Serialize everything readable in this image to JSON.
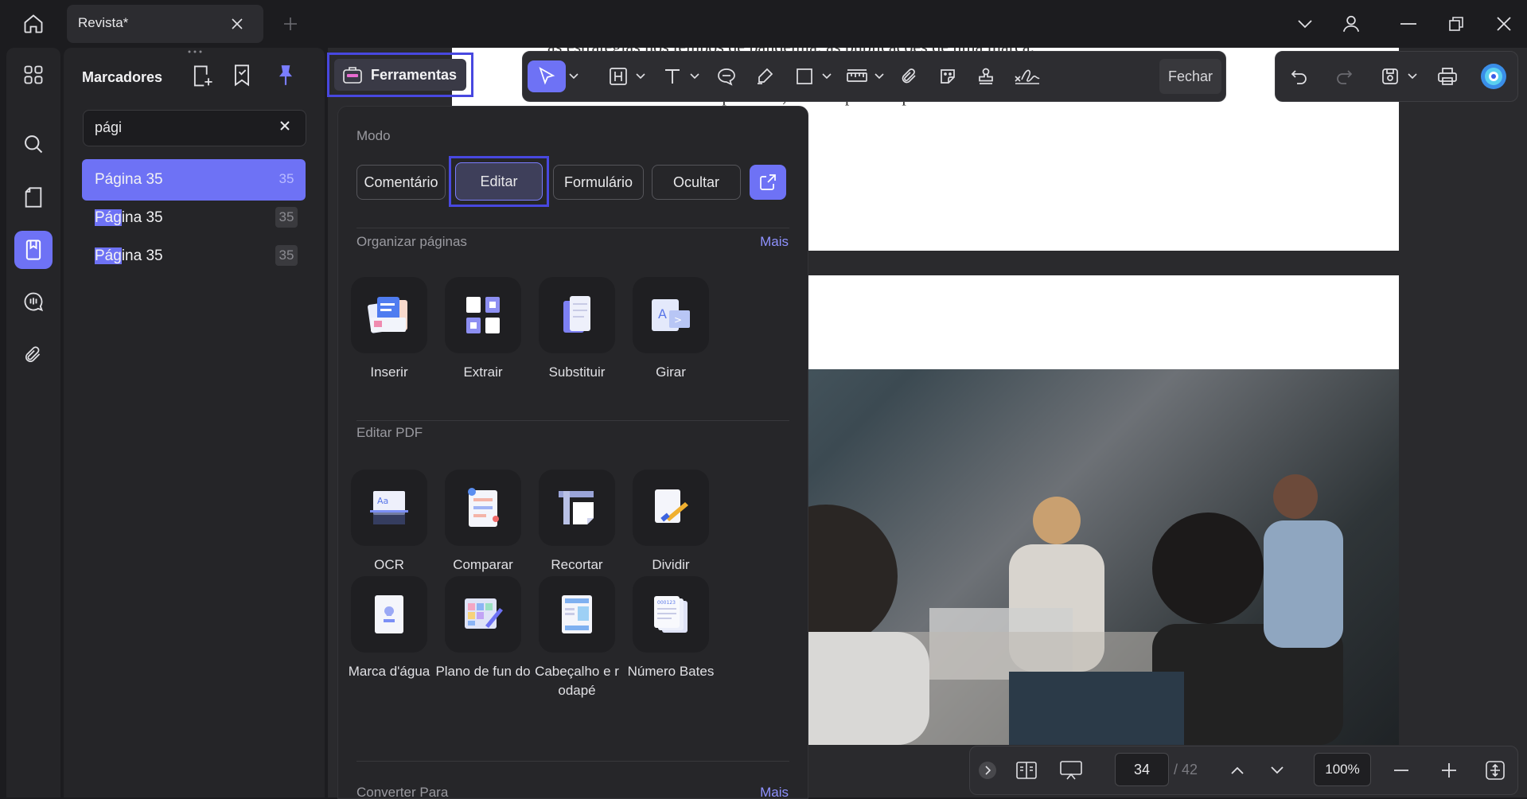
{
  "tab": {
    "title": "Revista*"
  },
  "bookmarks": {
    "title": "Marcadores",
    "search_value": "pági",
    "items": [
      {
        "pre": "",
        "highlight": "",
        "rest": "Página 35",
        "page": "35"
      },
      {
        "pre": "",
        "highlight": "Pág",
        "rest": "ina 35",
        "page": "35"
      },
      {
        "pre": "",
        "highlight": "Pág",
        "rest": "ina 35",
        "page": "35"
      }
    ]
  },
  "toolbar": {
    "ferramentas_label": "Ferramentas",
    "fechar_label": "Fechar"
  },
  "tools_panel": {
    "mode_title": "Modo",
    "modes": [
      "Comentário",
      "Editar",
      "Formulário",
      "Ocultar"
    ],
    "active_mode": "Editar",
    "organize": {
      "title": "Organizar páginas",
      "more": "Mais",
      "tools": [
        "Inserir",
        "Extrair",
        "Substituir",
        "Girar"
      ]
    },
    "edit_pdf": {
      "title": "Editar PDF",
      "tools_row1": [
        "OCR",
        "Comparar",
        "Recortar",
        "Dividir"
      ],
      "tools_row2": [
        "Marca d'água",
        "Plano de fun do",
        "Cabeçalho e r odapé",
        "Número Bates"
      ]
    },
    "convert": {
      "title": "Converter Para",
      "more": "Mais"
    }
  },
  "document": {
    "lines": [
      "as estratégias nos tempos de pandemia, as publicações de uma marca.",
      "construindo nos temas reportados, estarão prontos para levarem as"
    ]
  },
  "navigation": {
    "current_page": "34",
    "total_pages": "/ 42",
    "zoom": "100%"
  },
  "colors": {
    "accent": "#6e72f5",
    "highlight_border": "#4848e0",
    "background": "#1c1c1f"
  }
}
